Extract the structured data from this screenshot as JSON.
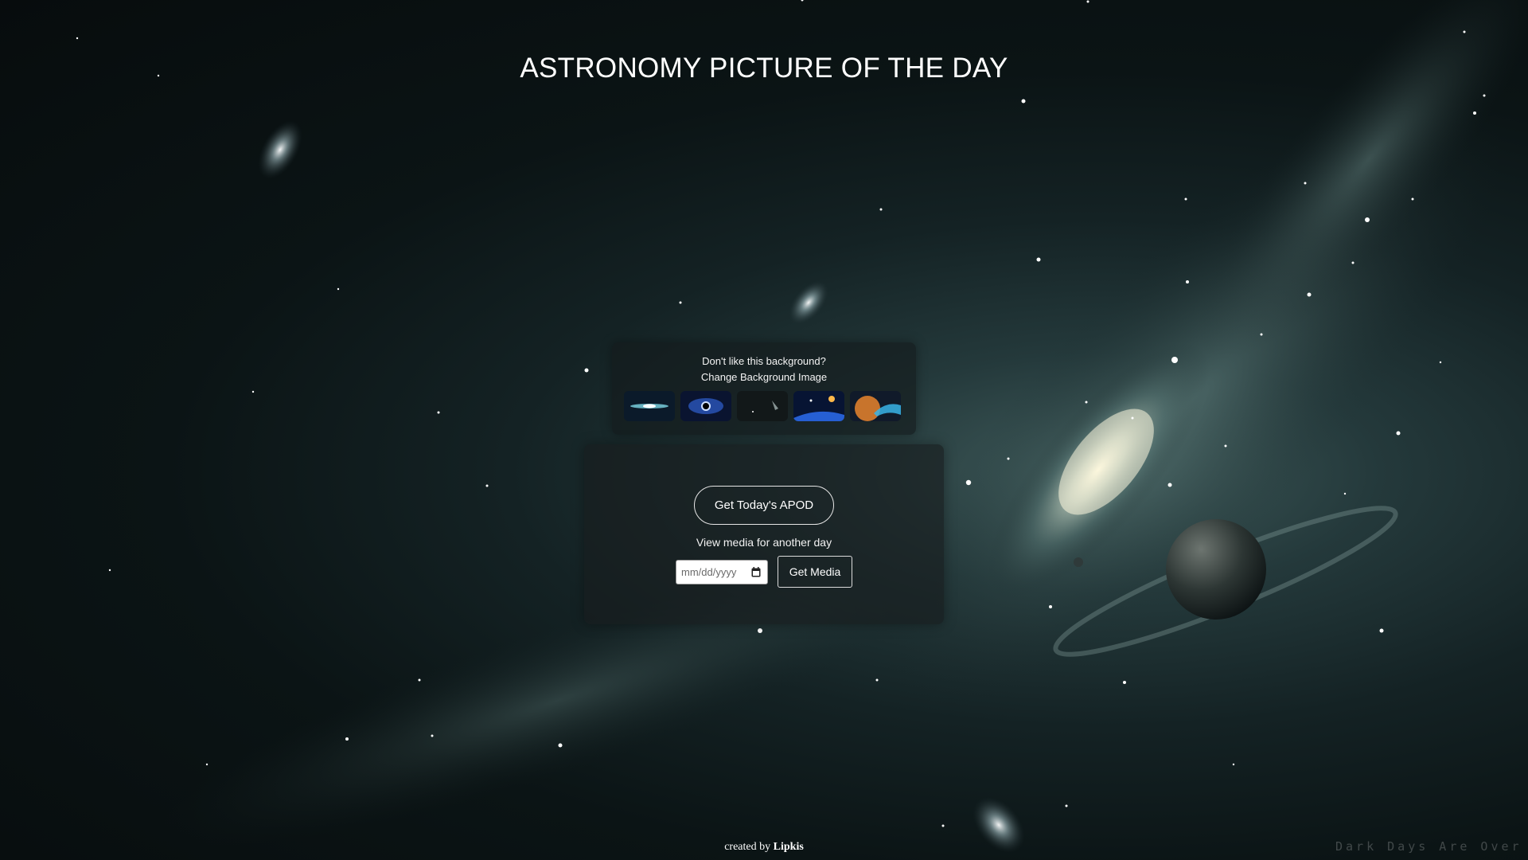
{
  "page": {
    "title": "ASTRONOMY PICTURE OF THE DAY"
  },
  "background_chooser": {
    "prompt": "Don't like this background?",
    "action_label": "Change Background Image",
    "thumbnails": [
      {
        "name": "edge-on-galaxy"
      },
      {
        "name": "black-hole"
      },
      {
        "name": "comet-streak"
      },
      {
        "name": "planet-horizon-sun"
      },
      {
        "name": "orange-planet-nebula"
      }
    ]
  },
  "apod": {
    "today_button_label": "Get Today's APOD",
    "another_day_label": "View media for another day",
    "date_placeholder": "mm/dd/yyyy",
    "get_media_label": "Get Media"
  },
  "footer": {
    "prefix": "created by",
    "author": "Lipkis"
  },
  "watermark": {
    "text": "Dark Days Are Over"
  },
  "colors": {
    "background_dark": "#070c0d",
    "nebula_teal": "#3f5a5a",
    "panel_bg": "#181c1e",
    "text": "#ffffff"
  }
}
